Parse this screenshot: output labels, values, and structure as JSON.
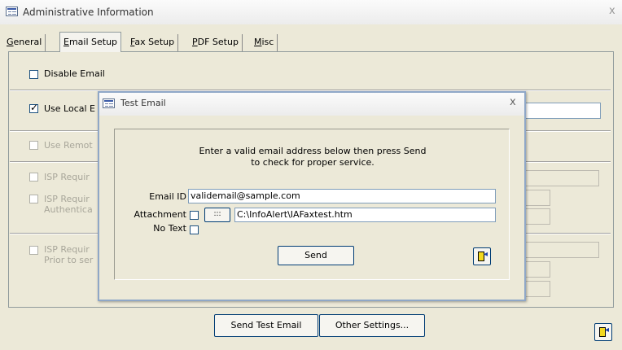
{
  "main_window": {
    "title": "Administrative Information",
    "close_glyph": "x"
  },
  "tabs": [
    {
      "prefix": "",
      "accel": "G",
      "rest": "eneral"
    },
    {
      "prefix": "",
      "accel": "E",
      "rest": "mail Setup"
    },
    {
      "prefix": "",
      "accel": "F",
      "rest": "ax Setup"
    },
    {
      "prefix": "",
      "accel": "P",
      "rest": "DF Setup"
    },
    {
      "prefix": "",
      "accel": "M",
      "rest": "isc"
    }
  ],
  "email_setup": {
    "disable_email": {
      "label": "Disable Email",
      "checked": false
    },
    "use_local": {
      "label": "Use Local E",
      "checked": true
    },
    "use_remote": {
      "label": "Use Remot",
      "checked": false
    },
    "isp_require_1": {
      "label": "ISP Requir",
      "checked": false
    },
    "isp_require_2": {
      "label_line1": "ISP Requir",
      "label_line2": "Authentica",
      "checked": false
    },
    "isp_require_3": {
      "label_line1": "ISP Requir",
      "label_line2": "Prior to ser",
      "checked": false
    }
  },
  "footer": {
    "send_test_email": "Send Test Email",
    "other_settings": "Other Settings..."
  },
  "icons": {
    "app": "form-icon",
    "exit": "exit-door-icon"
  },
  "dialog": {
    "title": "Test Email",
    "close_glyph": "x",
    "instruction_line1": "Enter a valid email address below then press Send",
    "instruction_line2": "to check for proper service.",
    "email_id_label": "Email ID",
    "email_id_value": "validemail@sample.com",
    "attachment_label": "Attachment",
    "attachment_checked": false,
    "browse_label": ":::",
    "attachment_path": "C:\\InfoAlert\\IAFaxtest.htm",
    "no_text_label": "No Text",
    "no_text_checked": false,
    "send_label": "Send"
  }
}
